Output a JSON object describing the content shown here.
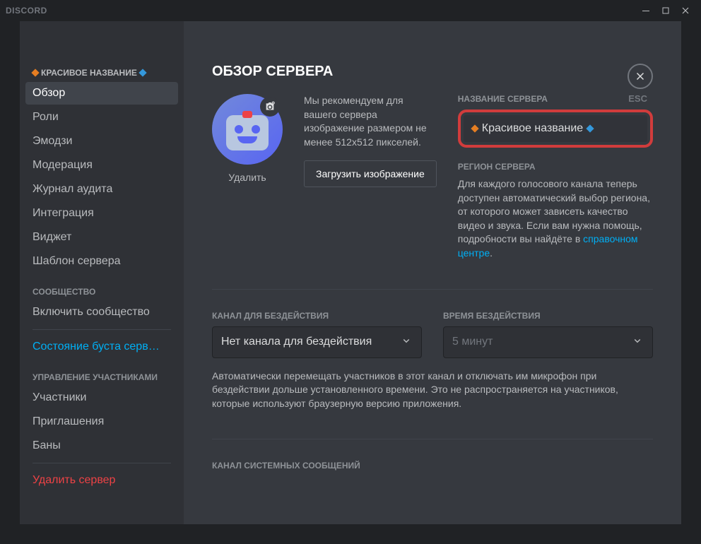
{
  "titlebar": {
    "app_name": "DISCORD"
  },
  "close": {
    "label": "ESC"
  },
  "sidebar": {
    "server_name": "КРАСИВОЕ НАЗВАНИЕ",
    "items": [
      {
        "label": "Обзор"
      },
      {
        "label": "Роли"
      },
      {
        "label": "Эмодзи"
      },
      {
        "label": "Модерация"
      },
      {
        "label": "Журнал аудита"
      },
      {
        "label": "Интеграция"
      },
      {
        "label": "Виджет"
      },
      {
        "label": "Шаблон сервера"
      }
    ],
    "community_header": "СООБЩЕСТВО",
    "community_items": [
      {
        "label": "Включить сообщество"
      }
    ],
    "boost_item": {
      "label": "Состояние буста серв…"
    },
    "management_header": "УПРАВЛЕНИЕ УЧАСТНИКАМИ",
    "management_items": [
      {
        "label": "Участники"
      },
      {
        "label": "Приглашения"
      },
      {
        "label": "Баны"
      }
    ],
    "delete_item": {
      "label": "Удалить сервер"
    }
  },
  "page": {
    "title": "ОБЗОР СЕРВЕРА",
    "avatar_remove": "Удалить",
    "image_desc": "Мы рекомендуем для вашего сервера изображение размером не менее 512x512 пикселей.",
    "upload_btn": "Загрузить изображение",
    "server_name_label": "НАЗВАНИЕ СЕРВЕРА",
    "server_name_value": "Красивое название",
    "region_label": "РЕГИОН СЕРВЕРА",
    "region_text": "Для каждого голосового канала теперь доступен автоматический выбор региона, от которого может зависеть качество видео и звука. Если вам нужна помощь, подробности вы найдёте в ",
    "region_link": "справочном центре",
    "idle_channel_label": "КАНАЛ ДЛЯ БЕЗДЕЙСТВИЯ",
    "idle_channel_value": "Нет канала для бездействия",
    "idle_time_label": "ВРЕМЯ БЕЗДЕЙСТВИЯ",
    "idle_time_value": "5 минут",
    "idle_help": "Автоматически перемещать участников в этот канал и отключать им микрофон при бездействии дольше установленного времени. Это не распространяется на участников, которые используют браузерную версию приложения.",
    "system_channel_label": "КАНАЛ СИСТЕМНЫХ СООБЩЕНИЙ"
  }
}
